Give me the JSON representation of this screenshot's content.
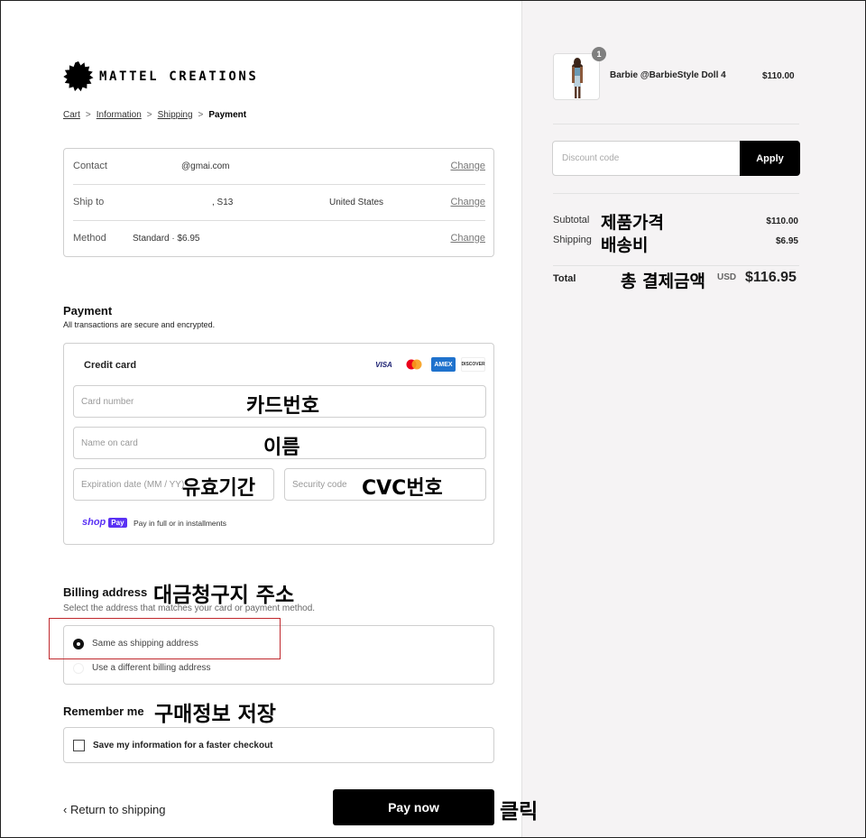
{
  "brand": {
    "name": "MATTEL CREATIONS"
  },
  "breadcrumb": {
    "cart": "Cart",
    "information": "Information",
    "shipping": "Shipping",
    "payment": "Payment",
    "sep": ">"
  },
  "info": {
    "contact_label": "Contact",
    "contact_value": "@gmai.com",
    "ship_label": "Ship to",
    "ship_value": ", S13",
    "ship_country": "United States",
    "method_label": "Method",
    "method_value": "Standard · $6.95",
    "change": "Change"
  },
  "payment": {
    "title": "Payment",
    "subtitle": "All transactions are secure and encrypted.",
    "credit_card": "Credit card",
    "cards": [
      "VISA",
      "",
      "AMEX",
      "DISCOVER"
    ],
    "card_number_placeholder": "Card number",
    "name_placeholder": "Name on card",
    "expiry_placeholder": "Expiration date (MM / YY)",
    "security_placeholder": "Security code",
    "shop_word": "shop",
    "pay_word": "Pay",
    "installments": "Pay in full or in installments"
  },
  "billing": {
    "title": "Billing address",
    "subtitle": "Select the address that matches your card or payment method.",
    "same": "Same as shipping address",
    "different": "Use a different billing address"
  },
  "remember": {
    "title": "Remember me",
    "save": "Save my information for a faster checkout"
  },
  "footer": {
    "return": "Return to shipping",
    "pay_now": "Pay now"
  },
  "summary": {
    "quantity": "1",
    "product_name": "Barbie @BarbieStyle Doll 4",
    "product_price": "$110.00",
    "discount_placeholder": "Discount code",
    "apply": "Apply",
    "subtotal_label": "Subtotal",
    "subtotal_value": "$110.00",
    "shipping_label": "Shipping",
    "shipping_value": "$6.95",
    "total_label": "Total",
    "currency": "USD",
    "total_value": "$116.95"
  },
  "annotations": {
    "card_number": "카드번호",
    "name": "이름",
    "expiry": "유효기간",
    "cvc": "CVC번호",
    "billing": "대금청구지 주소",
    "remember": "구매정보 저장",
    "click": "클릭",
    "subtotal": "제품가격",
    "shipping": "배송비",
    "total": "총 결제금액"
  },
  "colors": {
    "accent": "#000000",
    "annotation_box": "#c0282d",
    "shop_pay": "#5a31f4"
  }
}
